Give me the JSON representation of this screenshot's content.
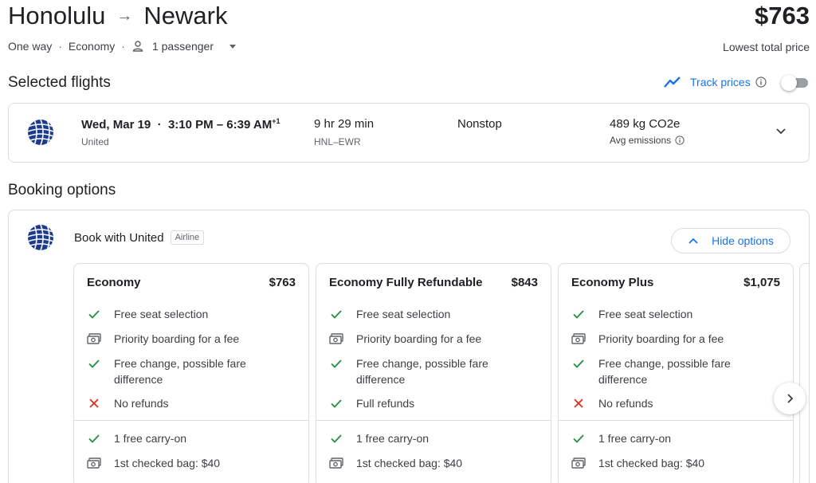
{
  "header": {
    "origin": "Honolulu",
    "destination": "Newark",
    "arrow": "→",
    "total_price": "$763",
    "lowest_label": "Lowest total price",
    "trip_type": "One way",
    "cabin": "Economy",
    "passengers": "1 passenger"
  },
  "selected": {
    "title": "Selected flights",
    "track_label": "Track prices",
    "track_enabled": false
  },
  "flight": {
    "date": "Wed, Mar 19",
    "times": "3:10 PM – 6:39 AM",
    "day_offset": "+1",
    "airline": "United",
    "duration": "9 hr 29 min",
    "airports": "HNL–EWR",
    "stops": "Nonstop",
    "emissions": "489 kg CO2e",
    "emissions_label": "Avg emissions"
  },
  "booking": {
    "title": "Booking options",
    "book_with": "Book with United",
    "badge": "Airline",
    "hide_options": "Hide options",
    "fares": [
      {
        "name": "Economy",
        "price": "$763",
        "features": [
          {
            "icon": "check",
            "line1": "Free seat selection",
            "line2": ""
          },
          {
            "icon": "money",
            "line1": "Priority boarding for a fee",
            "line2": ""
          },
          {
            "icon": "check",
            "line1": "Free change, possible fare",
            "line2": "difference"
          },
          {
            "icon": "cross",
            "line1": "No refunds",
            "line2": ""
          }
        ],
        "bags": [
          {
            "icon": "check",
            "text": "1 free carry-on"
          },
          {
            "icon": "money",
            "text": "1st checked bag: $40"
          }
        ]
      },
      {
        "name": "Economy Fully Refundable",
        "price": "$843",
        "features": [
          {
            "icon": "check",
            "line1": "Free seat selection",
            "line2": ""
          },
          {
            "icon": "money",
            "line1": "Priority boarding for a fee",
            "line2": ""
          },
          {
            "icon": "check",
            "line1": "Free change, possible fare",
            "line2": "difference"
          },
          {
            "icon": "check",
            "line1": "Full refunds",
            "line2": ""
          }
        ],
        "bags": [
          {
            "icon": "check",
            "text": "1 free carry-on"
          },
          {
            "icon": "money",
            "text": "1st checked bag: $40"
          }
        ]
      },
      {
        "name": "Economy Plus",
        "price": "$1,075",
        "features": [
          {
            "icon": "check",
            "line1": "Free seat selection",
            "line2": ""
          },
          {
            "icon": "money",
            "line1": "Priority boarding for a fee",
            "line2": ""
          },
          {
            "icon": "check",
            "line1": "Free change, possible fare",
            "line2": "difference"
          },
          {
            "icon": "cross",
            "line1": "No refunds",
            "line2": ""
          }
        ],
        "bags": [
          {
            "icon": "check",
            "text": "1 free carry-on"
          },
          {
            "icon": "money",
            "text": "1st checked bag: $40"
          }
        ]
      }
    ]
  },
  "colors": {
    "accent": "#1a73e8",
    "check": "#1e8e3e",
    "cross": "#d93025",
    "united_blue": "#1c3b8f"
  }
}
